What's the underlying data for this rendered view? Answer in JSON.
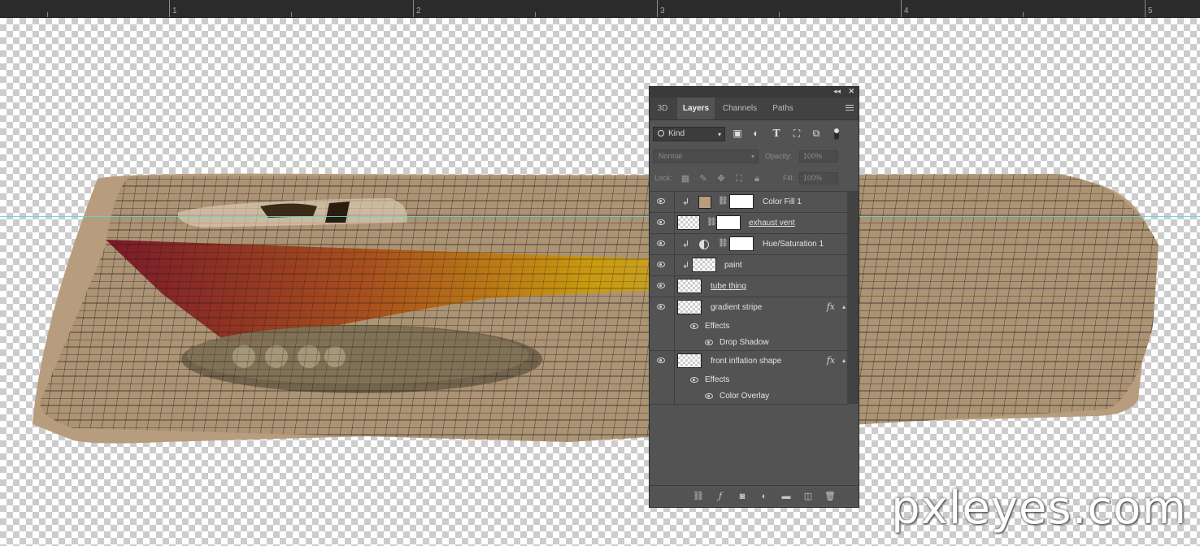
{
  "ruler": {
    "labels": [
      "1",
      "2",
      "3",
      "4",
      "5"
    ]
  },
  "watermark": "pxleyes.com",
  "panel": {
    "tabs": [
      {
        "label": "3D",
        "active": false
      },
      {
        "label": "Layers",
        "active": true
      },
      {
        "label": "Channels",
        "active": false
      },
      {
        "label": "Paths",
        "active": false
      }
    ],
    "filter_kind": "Kind",
    "blend_mode": "Normal",
    "opacity_label": "Opacity:",
    "opacity_value": "100%",
    "lock_label": "Lock:",
    "fill_label": "Fill:",
    "fill_value": "100%",
    "layers": [
      {
        "name": "Color Fill 1",
        "clipped": true,
        "type": "fill",
        "has_fx": false
      },
      {
        "name": "exhaust vent",
        "clipped": false,
        "type": "smart-mask",
        "has_fx": false
      },
      {
        "name": "Hue/Saturation 1",
        "clipped": true,
        "type": "adjustment",
        "has_fx": false
      },
      {
        "name": "paint",
        "clipped": true,
        "type": "pixel",
        "has_fx": false
      },
      {
        "name": "tube thing",
        "clipped": false,
        "type": "pixel",
        "has_fx": false
      },
      {
        "name": "gradient stripe",
        "clipped": false,
        "type": "pixel",
        "has_fx": true,
        "effects_label": "Effects",
        "effects": [
          "Drop Shadow"
        ]
      },
      {
        "name": "front inflation shape",
        "clipped": false,
        "type": "pixel",
        "has_fx": true,
        "effects_label": "Effects",
        "effects": [
          "Color Overlay"
        ]
      }
    ],
    "fx_label": "fx"
  },
  "colors": {
    "fill_swatch": "#b79c7d",
    "panel_bg": "#535353",
    "guide": "#66d4d8"
  }
}
